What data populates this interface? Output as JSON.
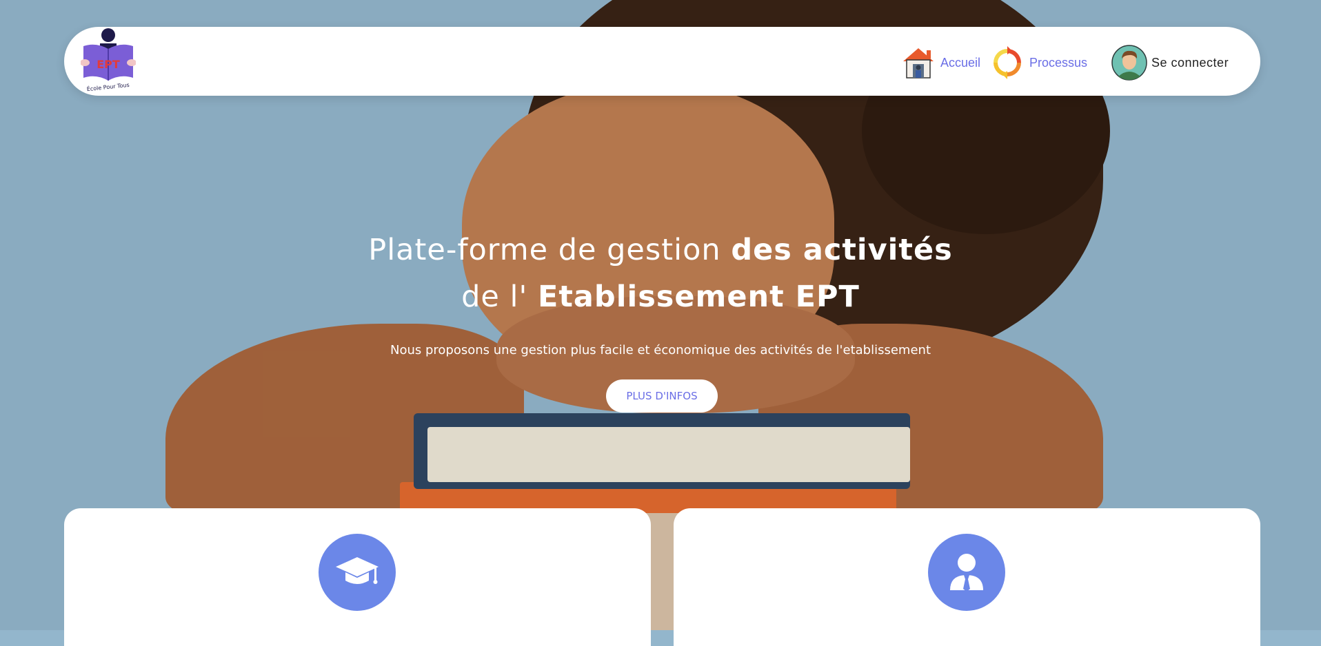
{
  "brand": {
    "logo_text": "EPT",
    "logo_tagline": "École Pour Tous"
  },
  "nav": {
    "items": [
      {
        "label": "Accueil",
        "icon": "home-icon"
      },
      {
        "label": "Processus",
        "icon": "process-cycle-icon"
      },
      {
        "label": "Se connecter",
        "icon": "user-avatar-icon"
      }
    ]
  },
  "hero": {
    "title_part1": "Plate-forme de gestion ",
    "title_bold1": "des activités",
    "title_part2": "de l' ",
    "title_bold2": "Etablissement EPT",
    "subtitle": "Nous proposons une gestion plus facile et économique des activités de l'etablissement",
    "cta_label": "PLUS D'INFOS"
  },
  "cards": [
    {
      "icon": "graduation-cap-icon"
    },
    {
      "icon": "person-icon"
    }
  ],
  "colors": {
    "accent": "#6a6ee6",
    "card_icon_bg": "#6b87e8",
    "hero_bg": "#93b6cc"
  }
}
